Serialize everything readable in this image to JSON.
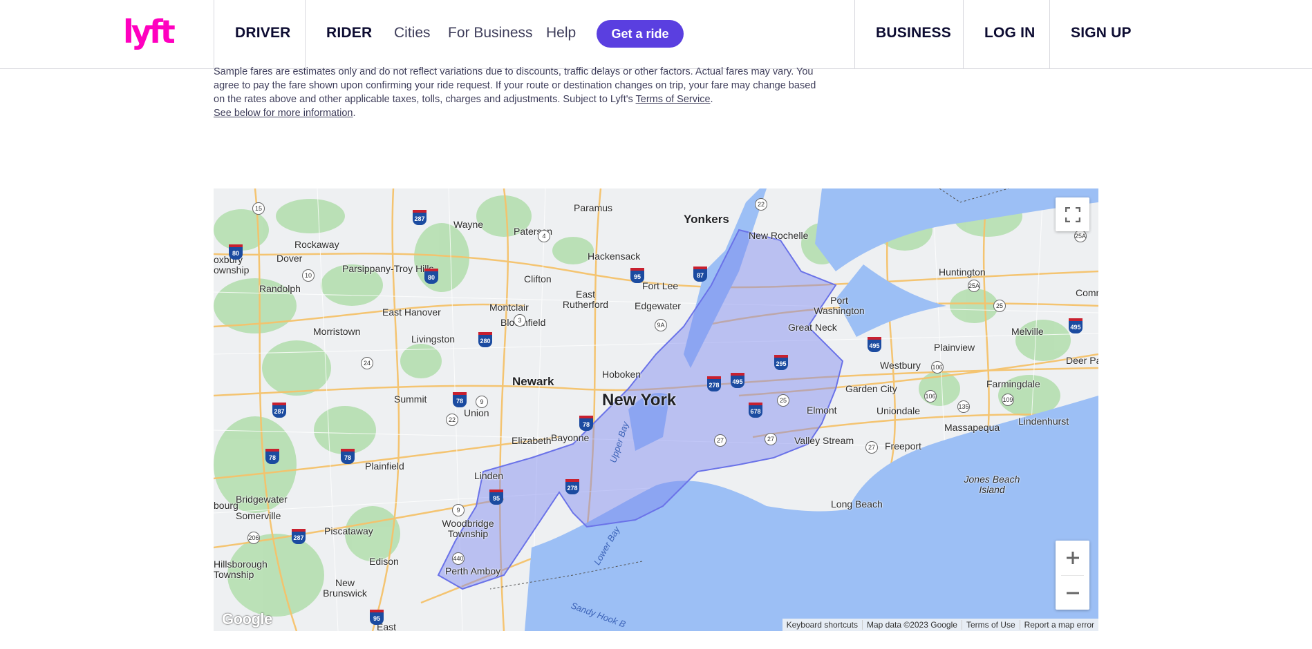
{
  "header": {
    "brand": "lyft",
    "nav_left": [
      "DRIVER",
      "RIDER"
    ],
    "nav_links": [
      "Cities",
      "For Business",
      "Help"
    ],
    "cta": "Get a ride",
    "nav_right": [
      "BUSINESS",
      "LOG IN",
      "SIGN UP"
    ],
    "brand_color": "#ff00bf",
    "cta_color": "#5a3fe0"
  },
  "disclaimer": {
    "line1": "Sample fares are estimates only and do not reflect variations due to discounts, traffic delays or other factors. Actual fares may vary. You",
    "line2": "agree to pay the fare shown upon confirming your ride request. If your route or destination changes on trip, your fare may change based",
    "line3_prefix": "on the rates above and other applicable taxes, tolls, charges and adjustments. Subject to Lyft's ",
    "tos_link": "Terms of Service",
    "line3_suffix": ".",
    "more_link": "See below for more information",
    "more_suffix": "."
  },
  "map": {
    "region_color": "#7b86f0",
    "water_color": "#9cbff5",
    "labels": {
      "new_york": "New York",
      "newark": "Newark",
      "yonkers": "Yonkers",
      "new_rochelle": "New Rochelle",
      "paramus": "Paramus",
      "wayne": "Wayne",
      "paterson": "Paterson",
      "hackensack": "Hackensack",
      "rockaway": "Rockaway",
      "dover": "Dover",
      "parsippany": "Parsippany-Troy Hills",
      "clifton": "Clifton",
      "fort_lee": "Fort Lee",
      "randolph": "Randolph",
      "montclair": "Montclair",
      "east_rutherford": "East Rutherford",
      "edgewater": "Edgewater",
      "east_hanover": "East Hanover",
      "bloomfield": "Bloomfield",
      "morristown": "Morristown",
      "livingston": "Livingston",
      "hoboken": "Hoboken",
      "summit": "Summit",
      "union": "Union",
      "elizabeth": "Elizabeth",
      "bayonne": "Bayonne",
      "plainfield": "Plainfield",
      "linden": "Linden",
      "bridgewater": "Bridgewater",
      "somerville": "Somerville",
      "piscataway": "Piscataway",
      "woodbridge": "Woodbridge Township",
      "edison": "Edison",
      "perth_amboy": "Perth Amboy",
      "hillsborough": "Hillsborough Township",
      "new_brunswick": "New Brunswick",
      "east": "East",
      "port_washington": "Port Washington",
      "great_neck": "Great Neck",
      "huntington": "Huntington",
      "melville": "Melville",
      "plainview": "Plainview",
      "westbury": "Westbury",
      "deer_park": "Deer Park",
      "garden_city": "Garden City",
      "farmingdale": "Farmingdale",
      "elmont": "Elmont",
      "uniondale": "Uniondale",
      "massapequa": "Massapequa",
      "lindenhurst": "Lindenhurst",
      "valley_stream": "Valley Stream",
      "freeport": "Freeport",
      "jones_beach": "Jones Beach Island",
      "long_beach": "Long Beach",
      "upper_bay": "Upper Bay",
      "lower_bay": "Lower Bay",
      "sandy_hook": "Sandy Hook B",
      "roxbury": "oxbury\nownship",
      "bourg": "bourg",
      "comma": "Comma"
    },
    "attribution": [
      "Keyboard shortcuts",
      "Map data ©2023 Google",
      "Terms of Use",
      "Report a map error"
    ],
    "google_logo": "Google"
  }
}
